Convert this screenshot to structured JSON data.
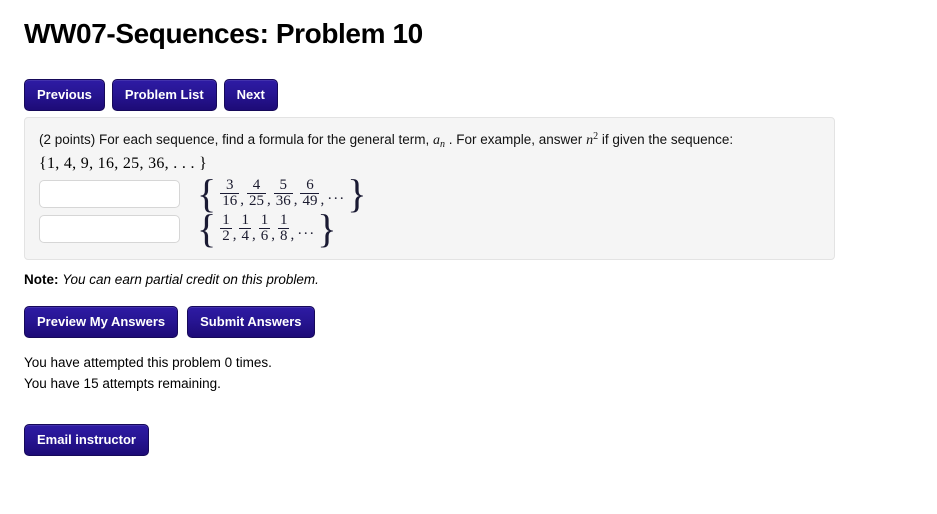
{
  "page": {
    "title": "WW07-Sequences: Problem 10"
  },
  "nav": {
    "buttons": [
      {
        "label": "Previous",
        "name": "previous-button"
      },
      {
        "label": "Problem List",
        "name": "problem-list-button"
      },
      {
        "label": "Next",
        "name": "next-button"
      }
    ]
  },
  "problem": {
    "points_prefix": "(2 points) For each sequence, find a formula for the general term,",
    "general_term_symbol": "a",
    "general_term_subscript": "n",
    "mid_text": ". For example, answer",
    "example_answer_base": "n",
    "example_answer_exponent": "2",
    "tail_text": "if given the sequence:",
    "example_sequence": "{1, 4, 9, 16, 25, 36, . . . }",
    "answers": [
      {
        "input_value": "",
        "input_placeholder": "",
        "sequence": {
          "open_brace": "{",
          "close_brace": "}",
          "terms": [
            {
              "num": "3",
              "den": "16"
            },
            {
              "num": "4",
              "den": "25"
            },
            {
              "num": "5",
              "den": "36"
            },
            {
              "num": "6",
              "den": "49"
            }
          ],
          "separator": ",",
          "ellipsis": "···"
        }
      },
      {
        "input_value": "",
        "input_placeholder": "",
        "sequence": {
          "open_brace": "{",
          "close_brace": "}",
          "terms": [
            {
              "num": "1",
              "den": "2"
            },
            {
              "num": "1",
              "den": "4"
            },
            {
              "num": "1",
              "den": "6"
            },
            {
              "num": "1",
              "den": "8"
            }
          ],
          "separator": ",",
          "ellipsis": "···"
        }
      }
    ]
  },
  "note": {
    "label": "Note:",
    "body": "You can earn partial credit on this problem."
  },
  "actions": {
    "buttons": [
      {
        "label": "Preview My Answers",
        "name": "preview-my-answers-button"
      },
      {
        "label": "Submit Answers",
        "name": "submit-answers-button"
      }
    ]
  },
  "attempts": {
    "attempted_line": "You have attempted this problem 0 times.",
    "remaining_line": "You have 15 attempts remaining.",
    "attempt_count": "0",
    "remaining_count": "15"
  },
  "footer": {
    "email_instructor_label": "Email instructor"
  },
  "colors": {
    "button_blue_top": "#2e1ba4",
    "button_blue_bottom": "#1d0b77",
    "panel_background": "#f5f5f5",
    "panel_border": "#e3e3e3",
    "page_background": "#ffffff",
    "text": "#000000"
  }
}
